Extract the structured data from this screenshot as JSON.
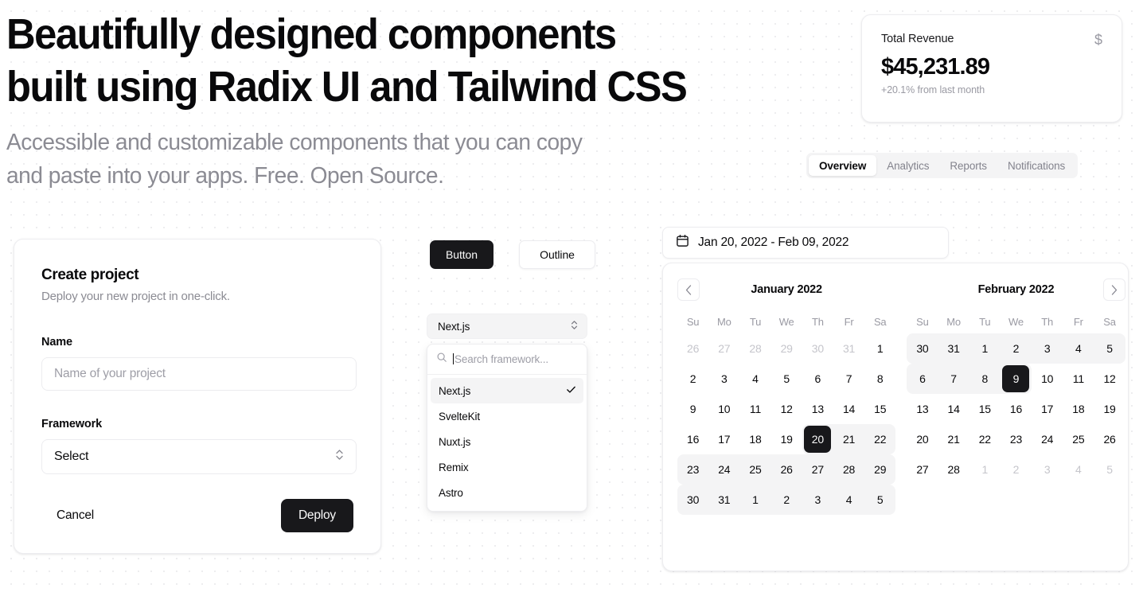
{
  "hero": {
    "title_line1": "Beautifully designed components",
    "title_line2": "built using Radix UI and Tailwind CSS",
    "subtitle_line1": "Accessible and customizable components that you can copy",
    "subtitle_line2": "and paste into your apps. Free. Open Source."
  },
  "revenue_card": {
    "title": "Total Revenue",
    "icon": "dollar-sign-icon",
    "icon_glyph": "$",
    "value": "$45,231.89",
    "change": "+20.1% from last month"
  },
  "tabs": {
    "items": [
      {
        "label": "Overview",
        "active": true
      },
      {
        "label": "Analytics",
        "active": false
      },
      {
        "label": "Reports",
        "active": false
      },
      {
        "label": "Notifications",
        "active": false
      }
    ]
  },
  "project_card": {
    "title": "Create project",
    "description": "Deploy your new project in one-click.",
    "name_label": "Name",
    "name_value": "",
    "name_placeholder": "Name of your project",
    "framework_label": "Framework",
    "framework_value": "Select",
    "cancel_label": "Cancel",
    "deploy_label": "Deploy"
  },
  "button_demo": {
    "primary_label": "Button",
    "outline_label": "Outline"
  },
  "combobox": {
    "trigger_value": "Next.js",
    "search_placeholder": "Search framework...",
    "search_value": "",
    "options": [
      {
        "label": "Next.js",
        "selected": true
      },
      {
        "label": "SvelteKit",
        "selected": false
      },
      {
        "label": "Nuxt.js",
        "selected": false
      },
      {
        "label": "Remix",
        "selected": false
      },
      {
        "label": "Astro",
        "selected": false
      }
    ]
  },
  "date_range": {
    "icon": "calendar-icon",
    "value": "Jan 20, 2022 - Feb 09, 2022"
  },
  "calendar": {
    "weekdays": [
      "Su",
      "Mo",
      "Tu",
      "We",
      "Th",
      "Fr",
      "Sa"
    ],
    "months": [
      {
        "title": "January 2022",
        "weeks": [
          [
            {
              "day": "26",
              "muted": true
            },
            {
              "day": "27",
              "muted": true
            },
            {
              "day": "28",
              "muted": true
            },
            {
              "day": "29",
              "muted": true
            },
            {
              "day": "30",
              "muted": true
            },
            {
              "day": "31",
              "muted": true
            },
            {
              "day": "1"
            }
          ],
          [
            {
              "day": "2"
            },
            {
              "day": "3"
            },
            {
              "day": "4"
            },
            {
              "day": "5"
            },
            {
              "day": "6"
            },
            {
              "day": "7"
            },
            {
              "day": "8"
            }
          ],
          [
            {
              "day": "9"
            },
            {
              "day": "10"
            },
            {
              "day": "11"
            },
            {
              "day": "12"
            },
            {
              "day": "13"
            },
            {
              "day": "14"
            },
            {
              "day": "15"
            }
          ],
          [
            {
              "day": "16"
            },
            {
              "day": "17"
            },
            {
              "day": "18"
            },
            {
              "day": "19"
            },
            {
              "day": "20",
              "selected": true,
              "range": true,
              "range_first": true
            },
            {
              "day": "21",
              "range": true
            },
            {
              "day": "22",
              "range": true,
              "range_last": true
            }
          ],
          [
            {
              "day": "23",
              "range": true,
              "range_first": true
            },
            {
              "day": "24",
              "range": true
            },
            {
              "day": "25",
              "range": true
            },
            {
              "day": "26",
              "range": true
            },
            {
              "day": "27",
              "range": true
            },
            {
              "day": "28",
              "range": true
            },
            {
              "day": "29",
              "range": true,
              "range_last": true
            }
          ],
          [
            {
              "day": "30",
              "range": true,
              "range_first": true
            },
            {
              "day": "31",
              "range": true
            },
            {
              "day": "1",
              "range": true
            },
            {
              "day": "2",
              "range": true
            },
            {
              "day": "3",
              "range": true
            },
            {
              "day": "4",
              "range": true
            },
            {
              "day": "5",
              "range": true,
              "range_last": true
            }
          ]
        ]
      },
      {
        "title": "February 2022",
        "weeks": [
          [
            {
              "day": "30",
              "range": true,
              "range_first": true
            },
            {
              "day": "31",
              "range": true
            },
            {
              "day": "1",
              "range": true
            },
            {
              "day": "2",
              "range": true
            },
            {
              "day": "3",
              "range": true
            },
            {
              "day": "4",
              "range": true
            },
            {
              "day": "5",
              "range": true,
              "range_last": true
            }
          ],
          [
            {
              "day": "6",
              "range": true,
              "range_first": true
            },
            {
              "day": "7",
              "range": true
            },
            {
              "day": "8",
              "range": true
            },
            {
              "day": "9",
              "selected": true,
              "range": true,
              "range_last": true
            },
            {
              "day": "10"
            },
            {
              "day": "11"
            },
            {
              "day": "12"
            }
          ],
          [
            {
              "day": "13"
            },
            {
              "day": "14"
            },
            {
              "day": "15"
            },
            {
              "day": "16"
            },
            {
              "day": "17"
            },
            {
              "day": "18"
            },
            {
              "day": "19"
            }
          ],
          [
            {
              "day": "20"
            },
            {
              "day": "21"
            },
            {
              "day": "22"
            },
            {
              "day": "23"
            },
            {
              "day": "24"
            },
            {
              "day": "25"
            },
            {
              "day": "26"
            }
          ],
          [
            {
              "day": "27"
            },
            {
              "day": "28"
            },
            {
              "day": "1",
              "muted": true
            },
            {
              "day": "2",
              "muted": true
            },
            {
              "day": "3",
              "muted": true
            },
            {
              "day": "4",
              "muted": true
            },
            {
              "day": "5",
              "muted": true
            }
          ]
        ]
      }
    ]
  },
  "colors": {
    "foreground": "#09090b",
    "muted_foreground": "#8b8b93",
    "primary": "#18181b",
    "accent_bg": "#f4f4f5",
    "border": "#ececef"
  }
}
